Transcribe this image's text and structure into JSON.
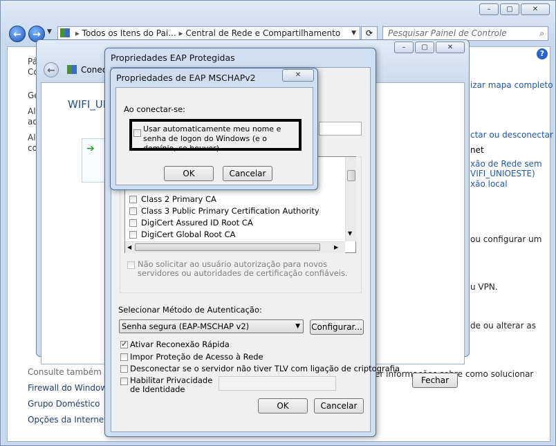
{
  "main": {
    "breadcrumb": [
      "Todos os Itens do Pai...",
      "Central de Rede e Compartilhamento"
    ],
    "search_placeholder": "Pesquisar Painel de Controle",
    "left_items": [
      "Pá",
      "Co",
      "Ge",
      "Alt",
      "ad",
      "Alt",
      "co"
    ],
    "right_items": [
      "izar mapa completo",
      "ctar ou desconectar",
      "net",
      "xão de Rede sem",
      "VIFI_UNIOESTE)",
      "xão local",
      "ou configurar um",
      "u VPN.",
      "de ou alterar as",
      "er informações sobre como solucionar"
    ],
    "see_also_heading": "Consulte também",
    "see_also": [
      "Firewall do Windows",
      "Grupo Doméstico",
      "Opções da Internet"
    ]
  },
  "conn": {
    "title": "Conec",
    "network": "WIFI_UN",
    "close_label": "Fechar"
  },
  "peap": {
    "title": "Propriedades EAP Protegidas",
    "certs": [
      "Class 2 Primary CA",
      "Class 3 Public Primary Certification Authority",
      "DigiCert Assured ID Root CA",
      "DigiCert Global Root CA"
    ],
    "no_prompt_text": "Não solicitar ao usuário autorização para novos servidores ou autoridades de certificação confiáveis.",
    "method_label": "Selecionar Método de Autenticação:",
    "method_value": "Senha segura (EAP-MSCHAP v2)",
    "configure_label": "Configurar...",
    "opt_fast_reconnect": "Ativar Reconexão Rápida",
    "opt_nap": "Impor Proteção de Acesso à Rede",
    "opt_tlv": "Desconectar se o servidor não tiver TLV com ligação de criptografia",
    "opt_privacy": "Habilitar Privacidade de Identidade",
    "ok_label": "OK",
    "cancel_label": "Cancelar"
  },
  "mschap": {
    "title": "Propriedades de EAP MSCHAPv2",
    "when_connecting": "Ao conectar-se:",
    "auto_credentials": "Usar automaticamente meu nome e senha de logon do Windows (e o domínio, se houver).",
    "ok_label": "OK",
    "cancel_label": "Cancelar"
  }
}
